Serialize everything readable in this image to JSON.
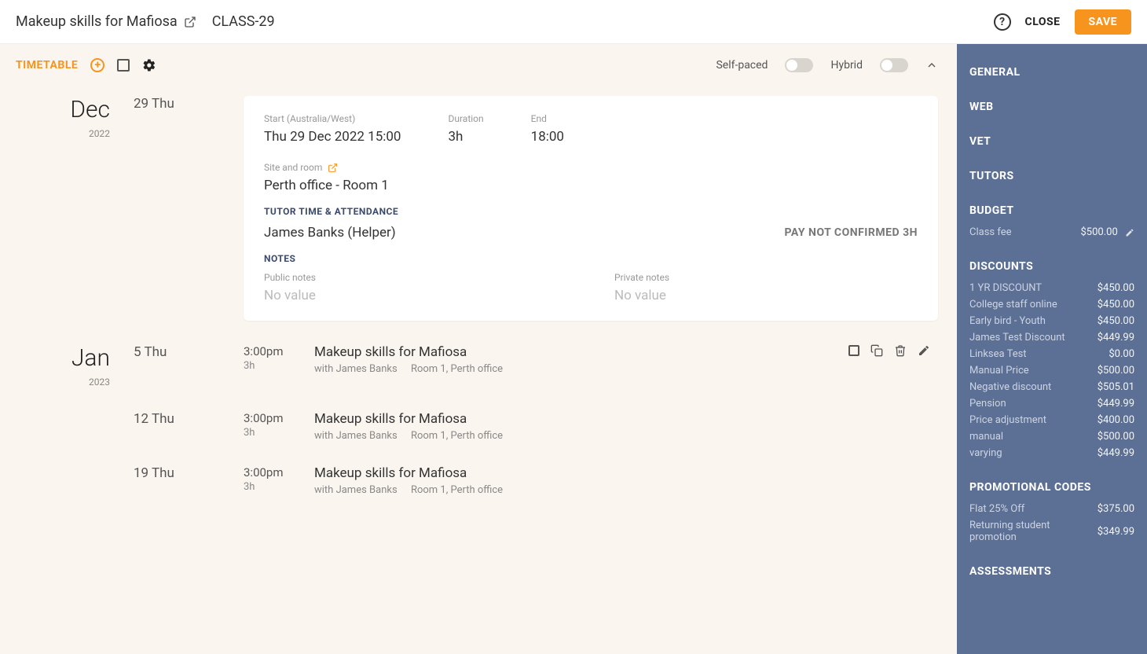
{
  "header": {
    "title": "Makeup skills for Mafiosa",
    "class_code": "CLASS-29",
    "close_label": "CLOSE",
    "save_label": "SAVE"
  },
  "toolbar": {
    "label": "TIMETABLE",
    "self_paced_label": "Self-paced",
    "hybrid_label": "Hybrid"
  },
  "expanded": {
    "start_label": "Start (Australia/West)",
    "start_value": "Thu 29 Dec 2022 15:00",
    "duration_label": "Duration",
    "duration_value": "3h",
    "end_label": "End",
    "end_value": "18:00",
    "site_label": "Site and room",
    "site_value": "Perth office - Room 1",
    "tutor_section": "TUTOR TIME & ATTENDANCE",
    "tutor_value": "James Banks (Helper)",
    "pay_status": "PAY NOT CONFIRMED 3H",
    "notes_section": "NOTES",
    "public_label": "Public notes",
    "public_value": "No value",
    "private_label": "Private notes",
    "private_value": "No value"
  },
  "months": [
    {
      "name": "Dec",
      "year": "2022"
    },
    {
      "name": "Jan",
      "year": "2023"
    }
  ],
  "dates": {
    "d0": "29 Thu",
    "d1": "5 Thu",
    "d2": "12 Thu",
    "d3": "19 Thu"
  },
  "sessions": [
    {
      "time": "3:00pm",
      "dur": "3h",
      "title": "Makeup skills for Mafiosa",
      "with": "with James Banks",
      "room": "Room 1, Perth office"
    },
    {
      "time": "3:00pm",
      "dur": "3h",
      "title": "Makeup skills for Mafiosa",
      "with": "with James Banks",
      "room": "Room 1, Perth office"
    },
    {
      "time": "3:00pm",
      "dur": "3h",
      "title": "Makeup skills for Mafiosa",
      "with": "with James Banks",
      "room": "Room 1, Perth office"
    }
  ],
  "sidebar": {
    "general": "GENERAL",
    "web": "WEB",
    "vet": "VET",
    "tutors": "TUTORS",
    "budget": "BUDGET",
    "class_fee_label": "Class fee",
    "class_fee_value": "$500.00",
    "discounts": "DISCOUNTS",
    "discount_items": [
      {
        "k": "1 YR DISCOUNT",
        "v": "$450.00"
      },
      {
        "k": "College staff online",
        "v": "$450.00"
      },
      {
        "k": "Early bird - Youth",
        "v": "$450.00"
      },
      {
        "k": "James Test Discount",
        "v": "$449.99"
      },
      {
        "k": "Linksea Test",
        "v": "$0.00"
      },
      {
        "k": "Manual Price",
        "v": "$500.00"
      },
      {
        "k": "Negative discount",
        "v": "$505.01"
      },
      {
        "k": "Pension",
        "v": "$449.99"
      },
      {
        "k": "Price adjustment",
        "v": "$400.00"
      },
      {
        "k": "manual",
        "v": "$500.00"
      },
      {
        "k": "varying",
        "v": "$449.99"
      }
    ],
    "promo": "PROMOTIONAL CODES",
    "promo_items": [
      {
        "k": "Flat 25% Off",
        "v": "$375.00"
      },
      {
        "k": "Returning student promotion",
        "v": "$349.99"
      }
    ],
    "assessments": "ASSESSMENTS"
  }
}
